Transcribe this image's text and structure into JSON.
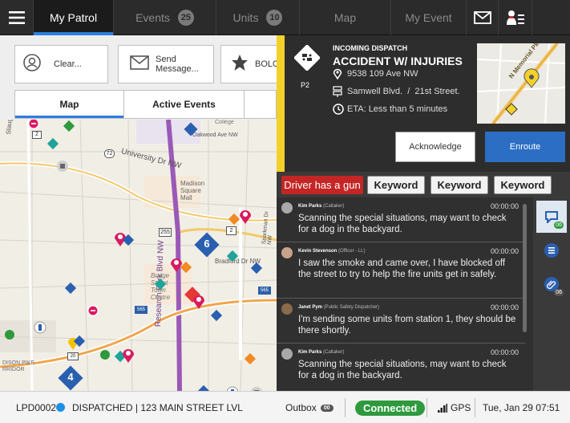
{
  "nav": {
    "tabs": [
      {
        "label": "My Patrol",
        "badge": ""
      },
      {
        "label": "Events",
        "badge": "25"
      },
      {
        "label": "Units",
        "badge": "10"
      },
      {
        "label": "Map",
        "badge": ""
      },
      {
        "label": "My Event",
        "badge": ""
      }
    ],
    "icons": [
      "hamburger-menu-icon",
      "envelope-icon",
      "officer-alert-icon"
    ]
  },
  "quick_actions": [
    {
      "label": "Clear...",
      "icon": "officer-icon"
    },
    {
      "label": "Send Message...",
      "icon": "envelope-icon"
    },
    {
      "label": "BOLO",
      "icon": "star-icon"
    }
  ],
  "subtabs": [
    "Map",
    "Active Events"
  ],
  "map": {
    "labels": [
      "Slaughter Rd",
      "University Dr NW",
      "Madison Square Mall",
      "Research Park Blvd NW",
      "Bradford Dr NW",
      "Bridge Street Town Centre",
      "DISON PIKE RRIDOR",
      "College",
      "Oakwood Ave NW",
      "Sparkman Dr NW"
    ],
    "route_shields": [
      "2",
      "72",
      "255",
      "2",
      "565",
      "565",
      "20"
    ],
    "clusters": [
      "6",
      "4"
    ]
  },
  "dispatch": {
    "heading": "INCOMING DISPATCH",
    "title": "ACCIDENT W/ INJURIES",
    "priority": "P2",
    "address": "9538 109 Ave NW",
    "cross_streets": "Samwell Blvd.  /  21st Street.",
    "eta": "ETA: Less than 5 minutes",
    "minimap_label": "N Memorial Pkwy",
    "acknowledge_label": "Acknowledge",
    "enroute_label": "Enroute",
    "colors": {
      "priority_bar": "#f3d02a",
      "enroute": "#2b6ec4"
    }
  },
  "keywords": [
    {
      "label": "Driver has a gun",
      "alert": true
    },
    {
      "label": "Keyword",
      "alert": false
    },
    {
      "label": "Keyword",
      "alert": false
    },
    {
      "label": "Keyword",
      "alert": false
    }
  ],
  "messages": [
    {
      "name": "Kim Parks",
      "role": "(Caltaker)",
      "time": "00:00:00",
      "text": "Scanning the special situations, may want to check for a dog in the backyard."
    },
    {
      "name": "Kevin Stevenson",
      "role": "(Officer - Lt.)",
      "time": "00:00:00",
      "text": "I saw the smoke and came over, I have blocked off the street to try to help the fire units get in safely."
    },
    {
      "name": "Janet Pym",
      "role": "(Public Safety Dispatcher)",
      "time": "00:00:00",
      "text": "I'm sending some units from station 1, they should be there shortly."
    },
    {
      "name": "Kim Parks",
      "role": "(Caltaker)",
      "time": "00:00:00",
      "text": "Scanning the special situations, may want to check for a dog in the backyard."
    }
  ],
  "rail": [
    {
      "icon": "chat-icon",
      "badge": "06"
    },
    {
      "icon": "list-icon",
      "badge": ""
    },
    {
      "icon": "attachment-icon",
      "badge": "06"
    }
  ],
  "status": {
    "unit": "LPD0002",
    "state": "DISPATCHED | 123 MAIN STREET LVL",
    "outbox_label": "Outbox",
    "outbox_count": "00",
    "connection": "Connected",
    "gps": "GPS",
    "datetime": "Tue, Jan 29 07:51",
    "colors": {
      "unit_dot": "#1e90e6",
      "connected": "#2e9a3d"
    }
  }
}
